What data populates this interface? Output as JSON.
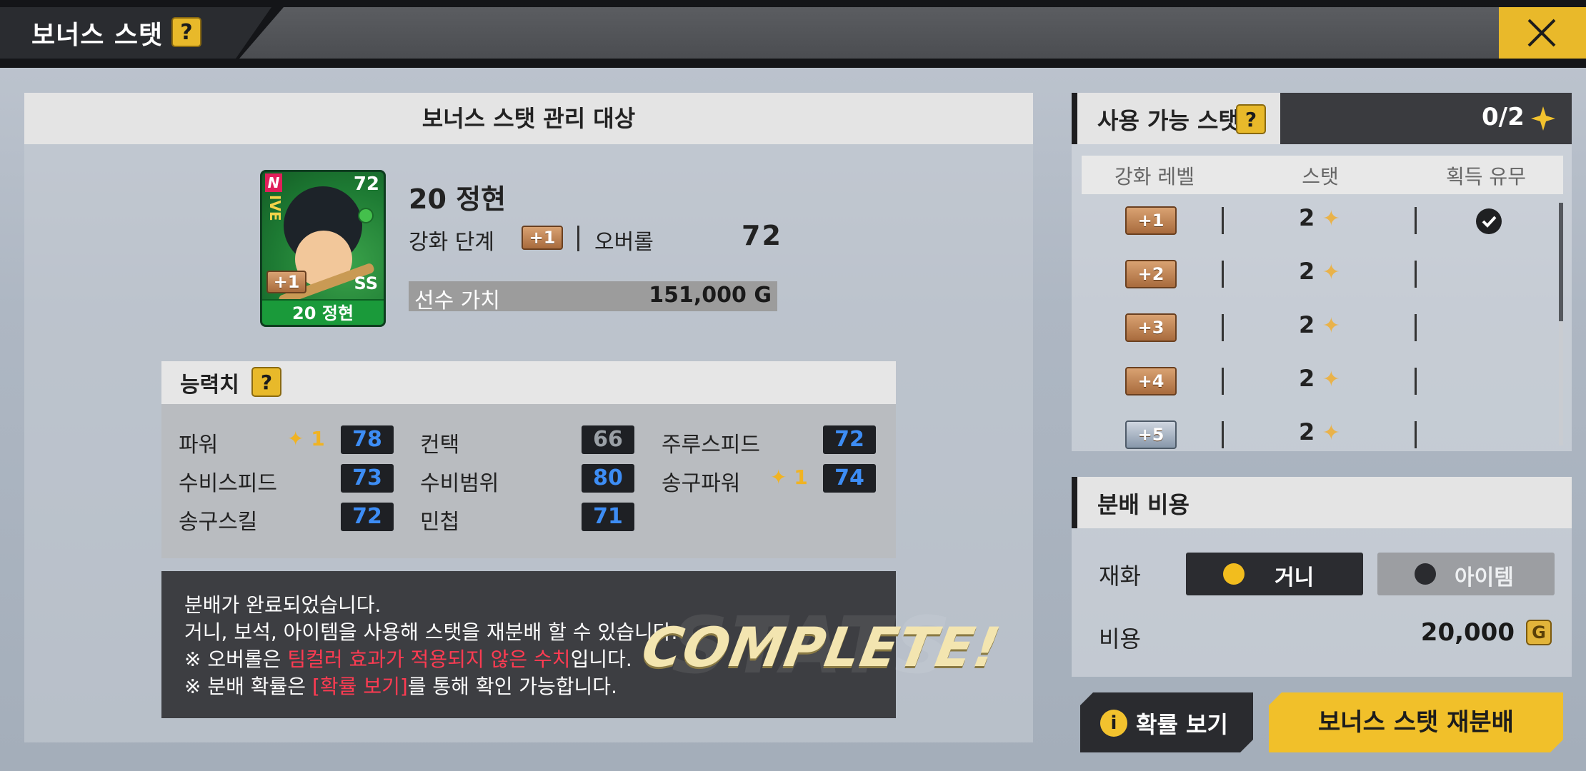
{
  "header": {
    "title": "보너스 스탯",
    "help": "?"
  },
  "left": {
    "title": "보너스 스탯 관리 대상",
    "card": {
      "grade": "N",
      "team": "IVE",
      "overall": "72",
      "position": "SS",
      "plus": "+1",
      "name": "20 정현"
    },
    "player": {
      "name": "20 정현",
      "level_label": "강화 단계",
      "level_badge": "+1",
      "overall_label": "오버롤",
      "overall_value": "72",
      "value_label": "선수 가치",
      "value_amount": "151,000",
      "value_unit": "G"
    },
    "stats": {
      "title": "능력치",
      "help": "?",
      "items": [
        {
          "label": "파워",
          "bonus": "1",
          "value": "78",
          "highlight": true
        },
        {
          "label": "컨택",
          "bonus": "",
          "value": "66",
          "highlight": false
        },
        {
          "label": "주루스피드",
          "bonus": "",
          "value": "72",
          "highlight": true
        },
        {
          "label": "수비스피드",
          "bonus": "",
          "value": "73",
          "highlight": true
        },
        {
          "label": "수비범위",
          "bonus": "",
          "value": "80",
          "highlight": true
        },
        {
          "label": "송구파워",
          "bonus": "1",
          "value": "74",
          "highlight": true
        },
        {
          "label": "송구스킬",
          "bonus": "",
          "value": "72",
          "highlight": true
        },
        {
          "label": "민첩",
          "bonus": "",
          "value": "71",
          "highlight": true
        }
      ]
    },
    "message": {
      "line1": "분배가 완료되었습니다.",
      "line2": "거니, 보석, 아이템을 사용해 스탯을 재분배 할 수 있습니다.",
      "line3_pre": "※ 오버롤은 ",
      "line3_red": "팀컬러 효과가 적용되지 않은 수치",
      "line3_post": "입니다.",
      "line4_pre": "※ 분배 확률은 ",
      "line4_red": "[확률 보기]",
      "line4_post": "를 통해 확인 가능합니다.",
      "complete": "COMPLETE!",
      "ghost": "STATS"
    }
  },
  "right": {
    "available": {
      "title": "사용 가능 스탯",
      "help": "?",
      "count": "0/2",
      "columns": [
        "강화 레벨",
        "스탯",
        "획득 유무"
      ],
      "rows": [
        {
          "level": "+1",
          "stat": "2",
          "acquired": true
        },
        {
          "level": "+2",
          "stat": "2",
          "acquired": false
        },
        {
          "level": "+3",
          "stat": "2",
          "acquired": false
        },
        {
          "level": "+4",
          "stat": "2",
          "acquired": false
        },
        {
          "level": "+5",
          "stat": "2",
          "acquired": false
        }
      ]
    },
    "cost": {
      "title": "분배 비용",
      "currency_label": "재화",
      "option_gunny": "거니",
      "option_item": "아이템",
      "cost_label": "비용",
      "cost_value": "20,000",
      "coin_symbol": "G"
    },
    "buttons": {
      "prob": "확률 보기",
      "redistribute": "보너스 스탯 재분배"
    }
  },
  "colors": {
    "accent_yellow": "#f1c02a",
    "stat_blue": "#3d8df5",
    "warning_red": "#ff3b52",
    "dark": "#2a2b2f"
  }
}
